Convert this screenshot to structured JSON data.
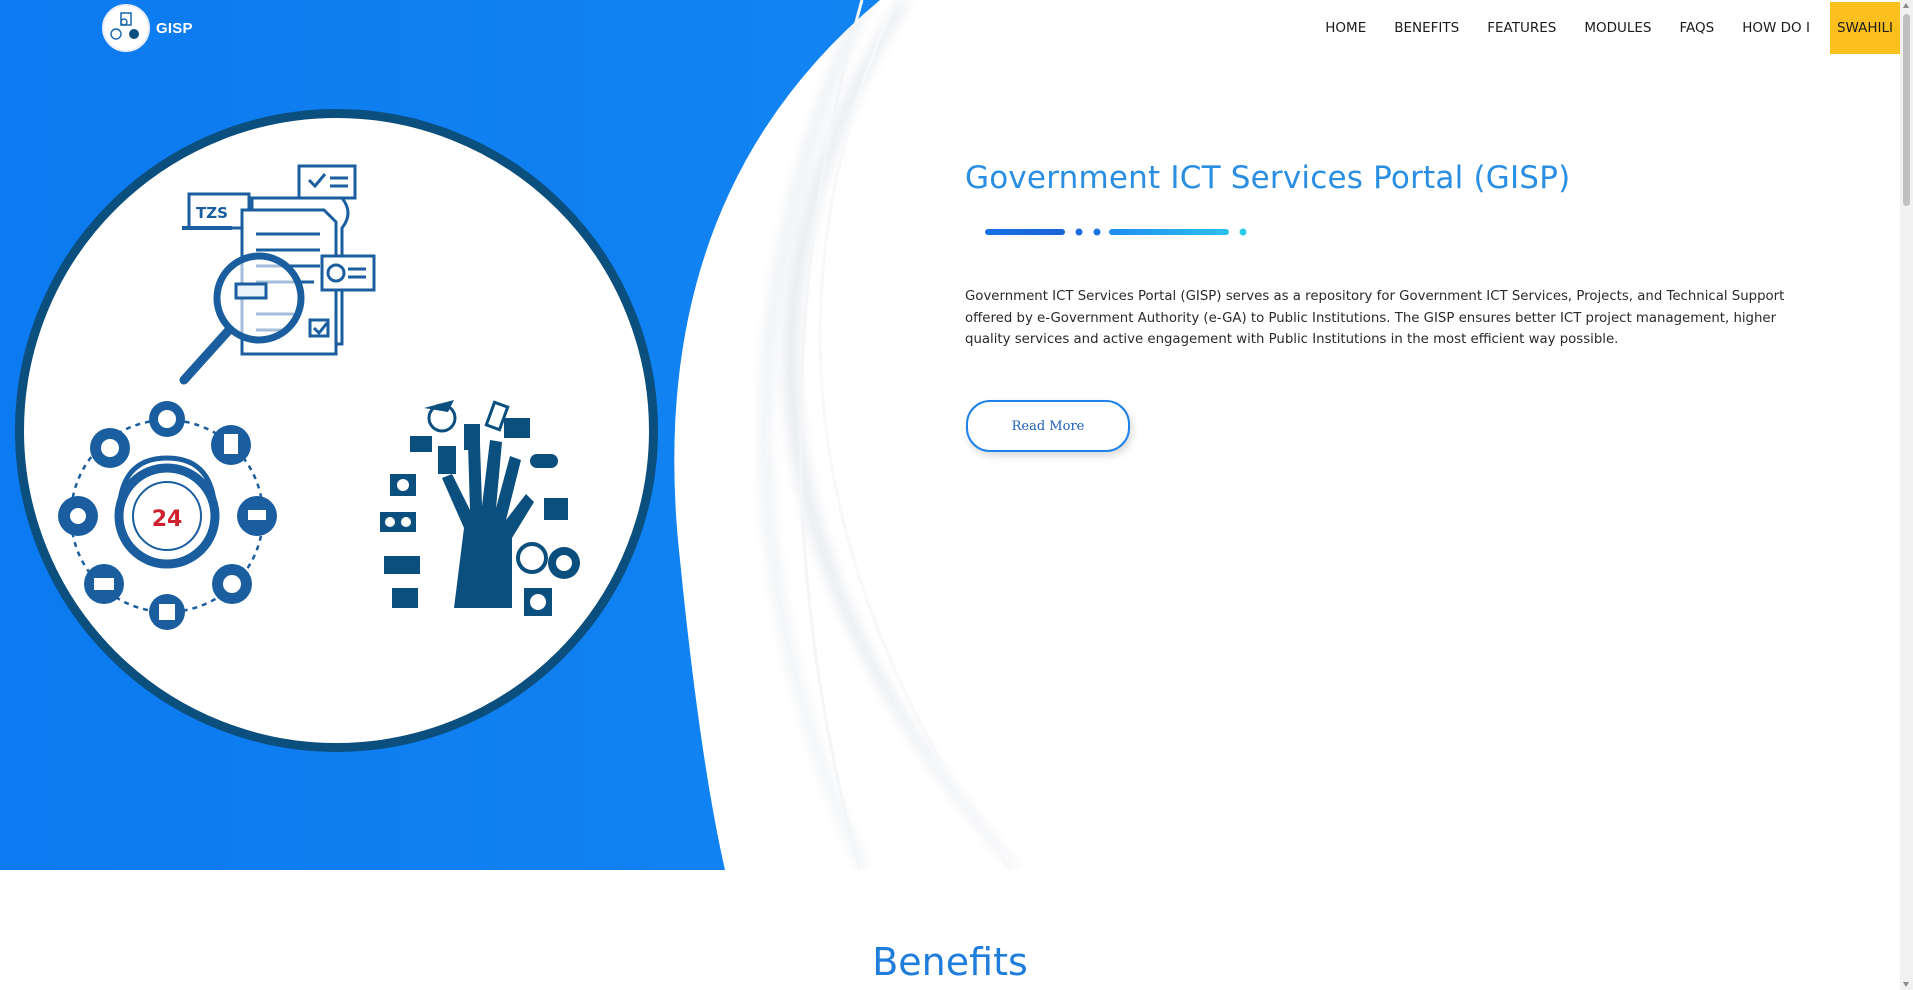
{
  "brand": {
    "name": "GISP",
    "logo_icon": "gisp-logo-icon"
  },
  "nav": {
    "items": [
      "HOME",
      "BENEFITS",
      "FEATURES",
      "MODULES",
      "FAQS",
      "HOW DO I"
    ],
    "language": "SWAHILI"
  },
  "hero": {
    "title": "Government ICT Services Portal (GISP)",
    "description": "Government ICT Services Portal (GISP) serves as a repository for Government ICT Services, Projects, and Technical Support offered by e-Government Authority (e-GA) to Public Institutions. The GISP ensures better ICT project management, higher quality services and active engagement with Public Institutions in the most efficient way possible.",
    "read_more": "Read More",
    "illustration": {
      "currency_label": "TZS",
      "clock_label": "24",
      "icons": [
        "document-search-icon",
        "support-24-icon",
        "ict-tree-icon"
      ]
    }
  },
  "benefits": {
    "title": "Benefits"
  },
  "colors": {
    "hero_blue": "#0d7ef0",
    "circle_border": "#0b4f7e",
    "title_blue": "#2a8ee3",
    "language_button": "#fbbf1e"
  }
}
